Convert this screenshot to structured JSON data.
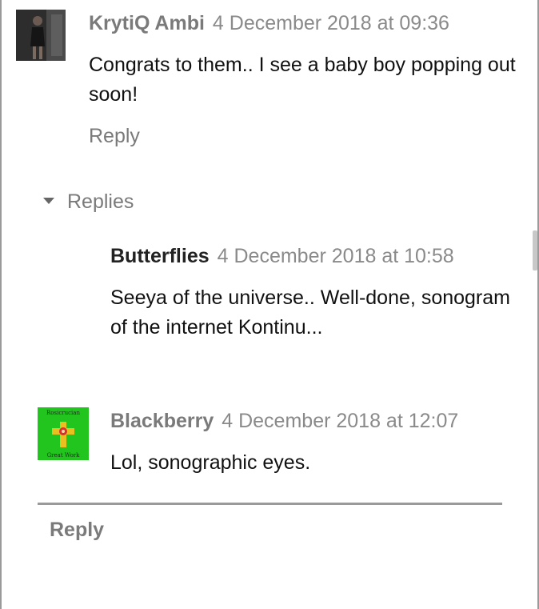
{
  "comment1": {
    "author": "KrytiQ Ambi",
    "date": "4 December 2018 at 09:36",
    "text": "Congrats to them.. I see a baby boy popping out soon!",
    "reply_label": "Reply"
  },
  "replies_toggle": {
    "label": "Replies"
  },
  "reply1": {
    "author": "Butterflies",
    "date": "4 December 2018 at 10:58",
    "text": "Seeya of the universe.. Well-done, sonogram of the internet Kontinu..."
  },
  "reply2": {
    "author": "Blackberry",
    "date": "4 December 2018 at 12:07",
    "text": "Lol, sonographic eyes.",
    "avatar_text_top": "Rosicrucian",
    "avatar_text_bottom": "Great Work"
  },
  "footer": {
    "reply_label": "Reply"
  },
  "colors": {
    "meta_gray": "#7a7a7a",
    "avatar_green": "#22c51e"
  }
}
